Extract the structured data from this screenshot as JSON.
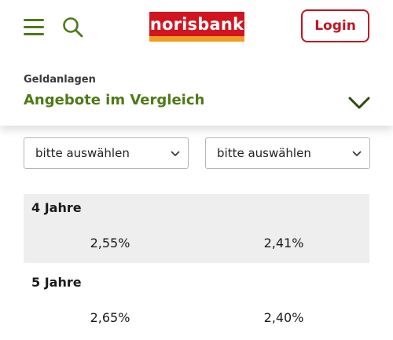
{
  "header": {
    "logo_text": "norisbank",
    "login_label": "Login",
    "breadcrumb": "Geldanlagen",
    "title": "Angebote im Vergleich"
  },
  "filters": [
    {
      "value": "bitte auswählen"
    },
    {
      "value": "bitte auswählen"
    }
  ],
  "rows": [
    {
      "term": "4 Jahre",
      "rate_a": "2,55%",
      "rate_b": "2,41%"
    },
    {
      "term": "5 Jahre",
      "rate_a": "2,65%",
      "rate_b": "2,40%"
    }
  ],
  "colors": {
    "brand_red": "#d11420",
    "brand_orange": "#f29b22",
    "accent_green": "#4d7a17"
  },
  "icons": [
    "menu-icon",
    "search-icon",
    "chevron-down-icon"
  ]
}
